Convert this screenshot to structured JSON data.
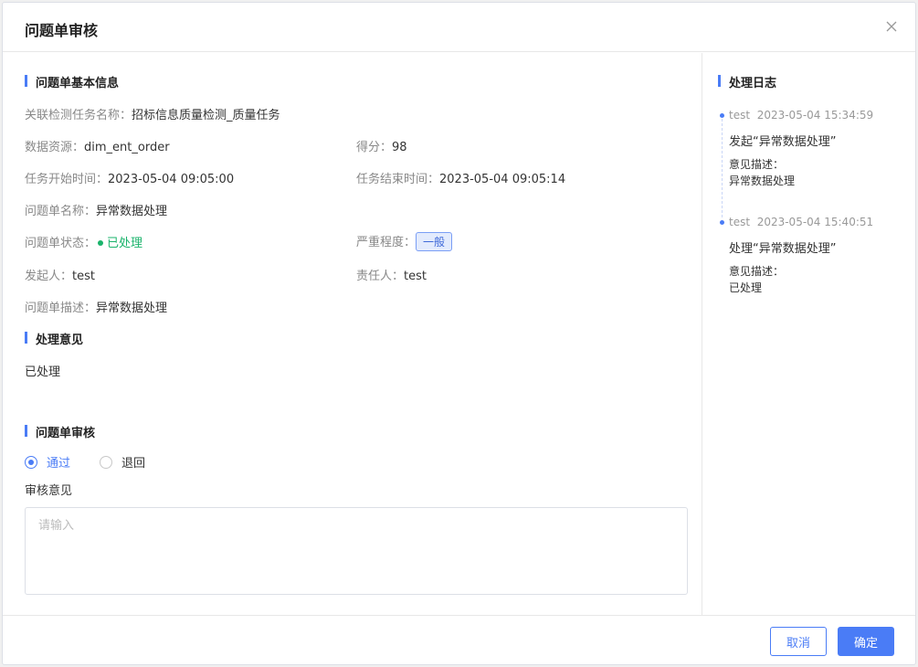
{
  "dialog": {
    "title": "问题单审核"
  },
  "basic": {
    "section_title": "问题单基本信息",
    "task_name_label": "关联检测任务名称：",
    "task_name": "招标信息质量检测_质量任务",
    "resource_label": "数据资源：",
    "resource": "dim_ent_order",
    "score_label": "得分：",
    "score": "98",
    "start_label": "任务开始时间：",
    "start": "2023-05-04 09:05:00",
    "end_label": "任务结束时间：",
    "end": "2023-05-04 09:05:14",
    "name_label": "问题单名称：",
    "name": "异常数据处理",
    "status_label": "问题单状态：",
    "status": "已处理",
    "severity_label": "严重程度：",
    "severity": "一般",
    "initiator_label": "发起人：",
    "initiator": "test",
    "owner_label": "责任人：",
    "owner": "test",
    "desc_label": "问题单描述：",
    "desc": "异常数据处理"
  },
  "opinion": {
    "section_title": "处理意见",
    "text": "已处理"
  },
  "review": {
    "section_title": "问题单审核",
    "options": [
      "通过",
      "退回"
    ],
    "selected": "通过",
    "comment_label": "审核意见",
    "placeholder": "请输入"
  },
  "log": {
    "section_title": "处理日志",
    "entries": [
      {
        "user": "test",
        "time": "2023-05-04 15:34:59",
        "action": "发起“异常数据处理”",
        "desc_label": "意见描述：",
        "desc": "异常数据处理"
      },
      {
        "user": "test",
        "time": "2023-05-04 15:40:51",
        "action": "处理“异常数据处理”",
        "desc_label": "意见描述：",
        "desc": "已处理"
      }
    ]
  },
  "footer": {
    "cancel": "取消",
    "ok": "确定"
  },
  "colors": {
    "accent": "#4a7cf6",
    "success": "#1ab36b"
  }
}
